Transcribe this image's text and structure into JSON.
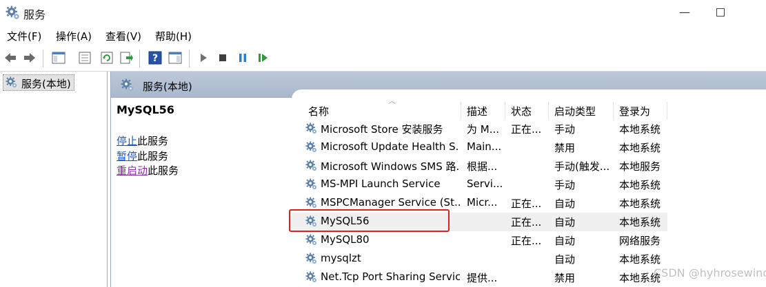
{
  "window": {
    "title": "服务",
    "minimize": "—"
  },
  "menu": [
    "文件(F)",
    "操作(A)",
    "查看(V)",
    "帮助(H)"
  ],
  "tree": {
    "root": "服务(本地)"
  },
  "panel": {
    "header": "服务(本地)",
    "selected_service": "MySQL56",
    "actions": [
      {
        "link": "停止",
        "suffix": "此服务"
      },
      {
        "link": "暂停",
        "suffix": "此服务"
      },
      {
        "link": "重启动",
        "suffix": "此服务"
      }
    ]
  },
  "columns": [
    "名称",
    "描述",
    "状态",
    "启动类型",
    "登录为"
  ],
  "services": [
    {
      "name": "Microsoft Store 安装服务",
      "desc": "为 M...",
      "status": "正在...",
      "start": "手动",
      "logon": "本地系统"
    },
    {
      "name": "Microsoft Update Health S...",
      "desc": "Main...",
      "status": "",
      "start": "禁用",
      "logon": "本地系统"
    },
    {
      "name": "Microsoft Windows SMS 路...",
      "desc": "根据...",
      "status": "",
      "start": "手动(触发...",
      "logon": "本地服务"
    },
    {
      "name": "MS-MPI Launch Service",
      "desc": "Servi...",
      "status": "",
      "start": "手动",
      "logon": "本地系统"
    },
    {
      "name": "MSPCManager Service (St...",
      "desc": "Micr...",
      "status": "正在...",
      "start": "自动",
      "logon": "本地系统"
    },
    {
      "name": "MySQL56",
      "desc": "",
      "status": "正在...",
      "start": "自动",
      "logon": "本地系统"
    },
    {
      "name": "MySQL80",
      "desc": "",
      "status": "正在...",
      "start": "自动",
      "logon": "网络服务"
    },
    {
      "name": "mysqlzt",
      "desc": "",
      "status": "",
      "start": "自动",
      "logon": "本地系统"
    },
    {
      "name": "Net.Tcp Port Sharing Service",
      "desc": "提供...",
      "status": "",
      "start": "禁用",
      "logon": "本地系统"
    }
  ],
  "watermark": "CSDN @hyhrosewind",
  "colors": {
    "highlight": "#e02020",
    "link": "#1a56c4",
    "visited_link": "#8a2aa8",
    "header_bg": "#b3c1d4"
  }
}
